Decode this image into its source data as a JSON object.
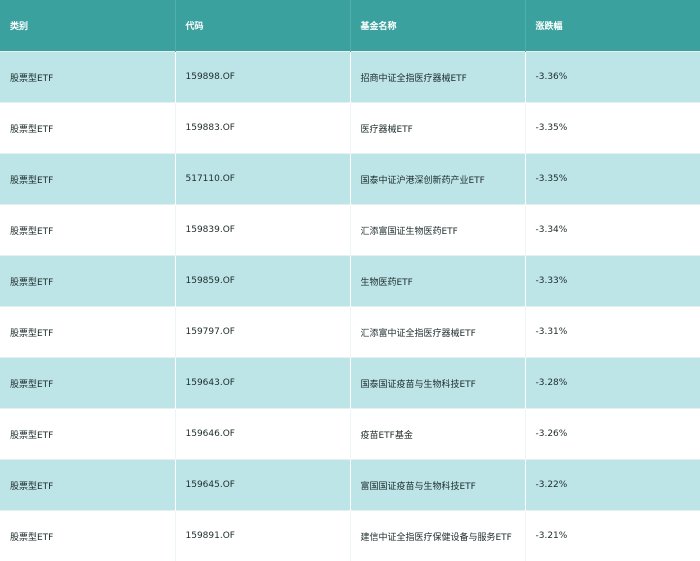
{
  "table": {
    "headers": [
      "类别",
      "代码",
      "基金名称",
      "涨跌幅"
    ],
    "rows": [
      [
        "股票型ETF",
        "159898.OF",
        "招商中证全指医疗器械ETF",
        "-3.36%"
      ],
      [
        "股票型ETF",
        "159883.OF",
        "医疗器械ETF",
        "-3.35%"
      ],
      [
        "股票型ETF",
        "517110.OF",
        "国泰中证沪港深创新药产业ETF",
        "-3.35%"
      ],
      [
        "股票型ETF",
        "159839.OF",
        "汇添富国证生物医药ETF",
        "-3.34%"
      ],
      [
        "股票型ETF",
        "159859.OF",
        "生物医药ETF",
        "-3.33%"
      ],
      [
        "股票型ETF",
        "159797.OF",
        "汇添富中证全指医疗器械ETF",
        "-3.31%"
      ],
      [
        "股票型ETF",
        "159643.OF",
        "国泰国证疫苗与生物科技ETF",
        "-3.28%"
      ],
      [
        "股票型ETF",
        "159646.OF",
        "疫苗ETF基金",
        "-3.26%"
      ],
      [
        "股票型ETF",
        "159645.OF",
        "富国国证疫苗与生物科技ETF",
        "-3.22%"
      ],
      [
        "股票型ETF",
        "159891.OF",
        "建信中证全指医疗保健设备与服务ETF",
        "-3.21%"
      ]
    ]
  },
  "colors": {
    "header_bg": "#3aa19f",
    "header_text": "#ffffff",
    "row_odd_bg": "#bde5e8",
    "row_even_bg": "#ffffff",
    "body_text": "#1d2b2b"
  }
}
